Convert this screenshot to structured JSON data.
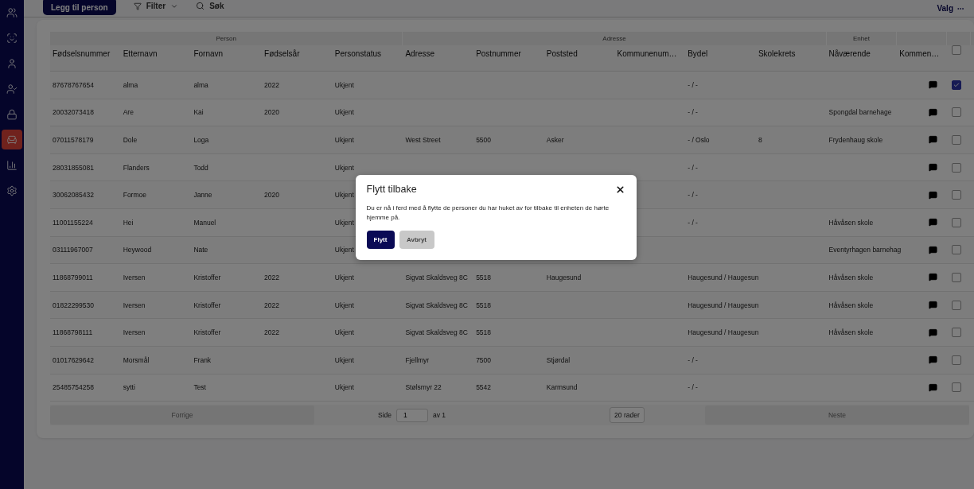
{
  "nav": [
    {
      "selected": false
    },
    {
      "selected": false
    },
    {
      "selected": false
    },
    {
      "selected": false
    },
    {
      "selected": false
    },
    {
      "selected": true
    },
    {
      "selected": false
    },
    {
      "selected": false
    }
  ],
  "toolbar": {
    "add_button": "Legg til person",
    "filter": "Filter",
    "search": "Søk",
    "options": "Valg"
  },
  "table": {
    "groups": [
      {
        "label": "Person",
        "columns": [
          "Fødselsnummer",
          "Etternavn",
          "Fornavn",
          "Fødselsår",
          "Personstatus"
        ]
      },
      {
        "label": "Adresse",
        "columns": [
          "Adresse",
          "Postnummer",
          "Poststed",
          "Kommunenum…",
          "Bydel",
          "Skolekrets"
        ]
      },
      {
        "label": "Enhet",
        "columns": [
          "Nåværende"
        ]
      },
      {
        "columns": [
          "Kommen…"
        ]
      }
    ],
    "header_checked": false,
    "rows": [
      {
        "cells": [
          "87678767654",
          "alma",
          "alma",
          "2022",
          "Ukjent",
          null,
          null,
          null,
          null,
          "- / -",
          null,
          null
        ],
        "checked": true
      },
      {
        "cells": [
          "20032073418",
          "Are",
          "Kai",
          "2020",
          "Ukjent",
          null,
          null,
          null,
          null,
          "- / -",
          null,
          "Spongdal barnehage"
        ],
        "checked": false
      },
      {
        "cells": [
          "07011578179",
          "Dole",
          "Loga",
          null,
          "Ukjent",
          "West Street",
          "5500",
          "Asker",
          null,
          "- / Oslo",
          "8",
          "Frydenhaug skole"
        ],
        "checked": false
      },
      {
        "cells": [
          "28031855081",
          "Flanders",
          "Todd",
          null,
          "Ukjent",
          null,
          null,
          null,
          null,
          "- / -",
          null,
          null
        ],
        "checked": false
      },
      {
        "cells": [
          "30062085432",
          "Formoe",
          "Janne",
          "2020",
          "Ukjent",
          null,
          null,
          null,
          null,
          "- / -",
          null,
          null
        ],
        "checked": false
      },
      {
        "cells": [
          "11001155224",
          "Hei",
          "Manuel",
          null,
          "Ukjent",
          null,
          null,
          null,
          null,
          "- / -",
          null,
          "Håvåsen skole"
        ],
        "checked": false
      },
      {
        "cells": [
          "03111967007",
          "Heywood",
          "Nate",
          null,
          "Ukjent",
          null,
          null,
          null,
          null,
          null,
          null,
          "Eventyrhagen barnehag"
        ],
        "checked": false
      },
      {
        "cells": [
          "11868799011",
          "Iversen",
          "Kristoffer",
          "2022",
          "Ukjent",
          "Sigvat Skaldsveg 8C",
          "5518",
          "Haugesund",
          null,
          "Haugesund / Haugesun",
          null,
          "Håvåsen skole"
        ],
        "checked": false
      },
      {
        "cells": [
          "01822299530",
          "Iversen",
          "Kristoffer",
          "2022",
          "Ukjent",
          "Sigvat Skaldsveg 8C",
          "5518",
          null,
          null,
          "Haugesund / Haugesun",
          null,
          "Håvåsen skole"
        ],
        "checked": false
      },
      {
        "cells": [
          "11868798111",
          "Iversen",
          "Kristoffer",
          "2022",
          "Ukjent",
          "Sigvat Skaldsveg 8C",
          "5518",
          null,
          null,
          "Haugesund / Haugesun",
          null,
          "Håvåsen skole"
        ],
        "checked": false
      },
      {
        "cells": [
          "01017629642",
          "Morsmål",
          "Frank",
          null,
          "Ukjent",
          "Fjellmyr",
          "7500",
          "Stjørdal",
          null,
          "- / -",
          null,
          null
        ],
        "checked": false
      },
      {
        "cells": [
          "25485754258",
          "sytti",
          "Test",
          null,
          "Ukjent",
          "Stølsmyr 22",
          "5542",
          "Karmsund",
          null,
          "- / -",
          null,
          null
        ],
        "checked": false
      }
    ]
  },
  "pagination": {
    "previous": "Forrige",
    "page_label": "Side",
    "page": "1",
    "of": "av 1",
    "page_size": "20 rader",
    "next": "Neste"
  },
  "dialog": {
    "title": "Flytt tilbake",
    "message": "Du er nå i ferd med å flytte de personer du har huket av for tilbake til enheten de hørte hjemme på.",
    "buttons": [
      {
        "label": "Flytt",
        "kind": "primary"
      },
      {
        "label": "Avbryt",
        "kind": "secondary"
      }
    ]
  }
}
